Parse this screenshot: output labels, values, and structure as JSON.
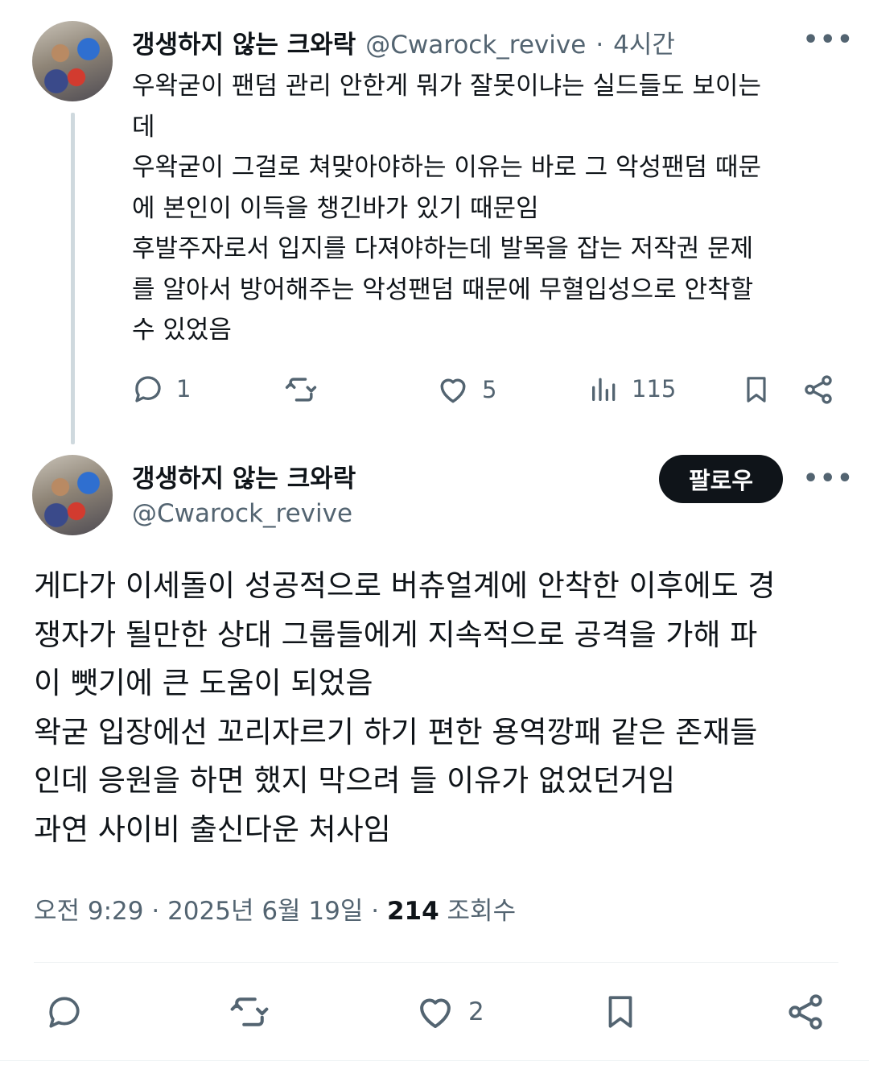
{
  "tweet1": {
    "display_name": "갱생하지 않는 크와락",
    "handle": "@Cwarock_revive",
    "separator": "·",
    "time": "4시간",
    "more_icon": "more-icon",
    "lines": [
      "우왁굳이 팬덤 관리 안한게 뭐가 잘못이냐는 실드들도 보이는",
      "데",
      "우왁굳이 그걸로 쳐맞아야하는 이유는 바로 그 악성팬덤 때문",
      "에 본인이 이득을 챙긴바가 있기 때문임",
      "후발주자로서 입지를 다져야하는데 발목을 잡는 저작권 문제",
      "를 알아서 방어해주는 악성팬덤 때문에 무혈입성으로 안착할",
      "수 있었음"
    ],
    "actions": {
      "reply_count": "1",
      "retweet_count": "",
      "like_count": "5",
      "views_count": "115"
    }
  },
  "tweet2": {
    "display_name": "갱생하지 않는 크와락",
    "handle": "@Cwarock_revive",
    "follow_label": "팔로우",
    "lines": [
      "게다가 이세돌이 성공적으로 버츄얼계에 안착한 이후에도 경",
      "쟁자가 될만한 상대 그룹들에게 지속적으로 공격을 가해 파",
      "이 뺏기에 큰 도움이 되었음",
      "왁굳 입장에선 꼬리자르기 하기 편한 용역깡패 같은 존재들",
      "인데 응원을 하면 했지 막으려 들 이유가 없었던거임",
      "과연 사이비 출신다운 처사임"
    ],
    "timestamp_prefix": "오전 9:29 · 2025년 6월 19일 · ",
    "views_number": "214",
    "views_suffix": " 조회수",
    "actions": {
      "like_count": "2"
    }
  },
  "colors": {
    "text_primary": "#0f1419",
    "text_secondary": "#536471",
    "thread_line": "#cfd9de",
    "follow_button_bg": "#0f1419"
  }
}
